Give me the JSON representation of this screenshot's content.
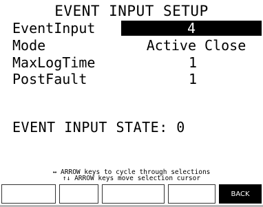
{
  "title": "EVENT INPUT SETUP",
  "fields": {
    "event_input": {
      "label": "EventInput",
      "value": "4"
    },
    "mode": {
      "label": "Mode",
      "value": "Active Close"
    },
    "max_log_time": {
      "label": "MaxLogTime",
      "value": "1"
    },
    "post_fault": {
      "label": "PostFault",
      "value": "1"
    }
  },
  "state": "EVENT INPUT STATE: 0",
  "help": {
    "line1": "↔ ARROW keys to cycle through selections",
    "line2": "↑↓ ARROW keys move selection cursor"
  },
  "softkeys": [
    "",
    "",
    "",
    "",
    "BACK"
  ],
  "colors": {
    "highlight_bg": "#000000",
    "highlight_fg": "#ffffff",
    "background": "#ffffff"
  }
}
